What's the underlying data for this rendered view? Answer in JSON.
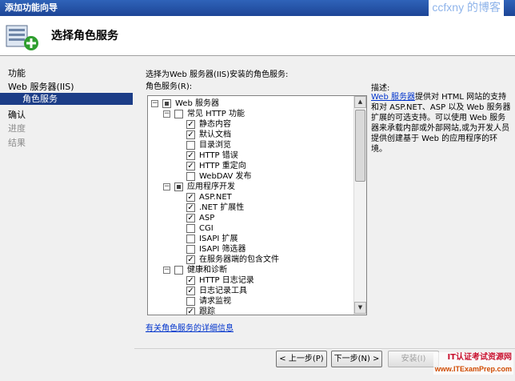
{
  "window": {
    "title": "添加功能向导",
    "watermark": "ccfxny 的博客"
  },
  "header": {
    "title": "选择角色服务"
  },
  "nav": {
    "items": [
      {
        "label": "功能",
        "state": "normal"
      },
      {
        "label": "Web 服务器(IIS)",
        "state": "normal"
      },
      {
        "label": "角色服务",
        "state": "selected"
      },
      {
        "label": "确认",
        "state": "normal"
      },
      {
        "label": "进度",
        "state": "disabled"
      },
      {
        "label": "结果",
        "state": "disabled"
      }
    ]
  },
  "main": {
    "instruction": "选择为Web 服务器(IIS)安装的角色服务:",
    "list_label": "角色服务(R):",
    "tree": [
      {
        "label": "Web 服务器",
        "checked": "partial",
        "expander": "minus"
      },
      {
        "label": "常见 HTTP 功能",
        "checked": "no",
        "expander": "minus"
      },
      {
        "label": "静态内容",
        "checked": "yes"
      },
      {
        "label": "默认文档",
        "checked": "yes"
      },
      {
        "label": "目录浏览",
        "checked": "no"
      },
      {
        "label": "HTTP 错误",
        "checked": "yes"
      },
      {
        "label": "HTTP 重定向",
        "checked": "yes"
      },
      {
        "label": "WebDAV 发布",
        "checked": "no"
      },
      {
        "label": "应用程序开发",
        "checked": "partial",
        "expander": "minus"
      },
      {
        "label": "ASP.NET",
        "checked": "yes"
      },
      {
        "label": ".NET 扩展性",
        "checked": "yes"
      },
      {
        "label": "ASP",
        "checked": "yes"
      },
      {
        "label": "CGI",
        "checked": "no"
      },
      {
        "label": "ISAPI 扩展",
        "checked": "no"
      },
      {
        "label": "ISAPI 筛选器",
        "checked": "no"
      },
      {
        "label": "在服务器端的包含文件",
        "checked": "yes"
      },
      {
        "label": "健康和诊断",
        "checked": "no",
        "expander": "minus"
      },
      {
        "label": "HTTP 日志记录",
        "checked": "yes"
      },
      {
        "label": "日志记录工具",
        "checked": "yes"
      },
      {
        "label": "请求监视",
        "checked": "no"
      },
      {
        "label": "跟踪",
        "checked": "yes"
      }
    ],
    "details_link": "有关角色服务的详细信息",
    "description_title": "描述:",
    "description_link": "Web 服务器",
    "description_text": "提供对 HTML 网站的支持和对 ASP.NET、ASP 以及 Web 服务器扩展的可选支持。可以使用 Web 服务器来承载内部或外部网站,或为开发人员提供创建基于 Web 的应用程序的环境。"
  },
  "buttons": {
    "prev": "< 上一步(P)",
    "next": "下一步(N) >",
    "install": "安装(I)"
  },
  "watermark_bottom": {
    "line1": "IT认证考试资源网",
    "line2": "www.ITExamPrep.com"
  }
}
